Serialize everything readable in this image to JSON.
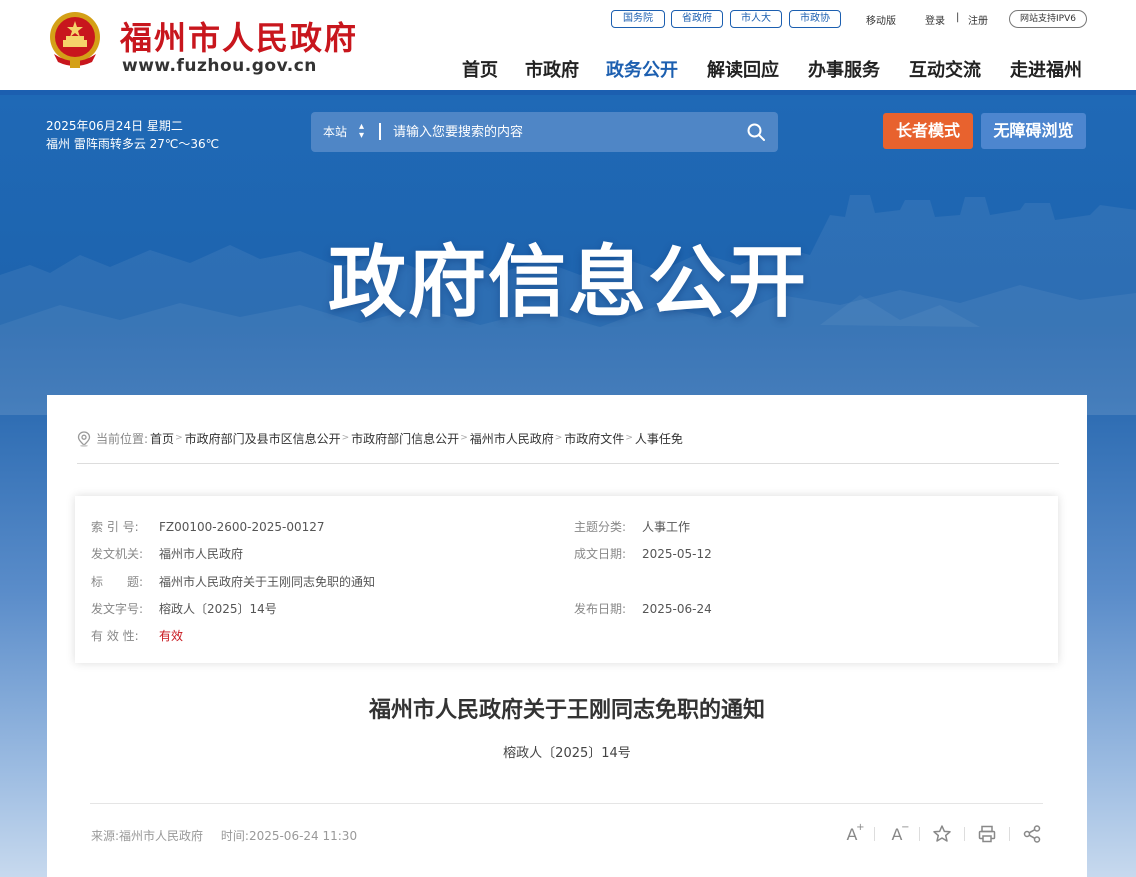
{
  "header": {
    "site_name": "福州市人民政府",
    "site_url": "www.fuzhou.gov.cn",
    "top_links": [
      "国务院",
      "省政府",
      "市人大",
      "市政协"
    ],
    "mobile": "移动版",
    "login": "登录",
    "register": "注册",
    "ipv6": "网站支持IPV6",
    "nav": [
      "首页",
      "市政府",
      "政务公开",
      "解读回应",
      "办事服务",
      "互动交流",
      "走进福州"
    ],
    "nav_active": "政务公开"
  },
  "toolbar": {
    "date": "2025年06月24日 星期二",
    "weather": "福州 雷阵雨转多云 27℃～36℃",
    "search_scope": "本站",
    "search_placeholder": "请输入您要搜索的内容",
    "elder_mode": "长者模式",
    "accessible": "无障碍浏览"
  },
  "banner": {
    "title": "政府信息公开"
  },
  "breadcrumb": {
    "label": "当前位置:",
    "items": [
      "首页",
      "市政府部门及县市区信息公开",
      "市政府部门信息公开",
      "福州市人民政府",
      "市政府文件",
      "人事任免"
    ]
  },
  "meta": {
    "index_label": "索 引 号:",
    "index": "FZ00100-2600-2025-00127",
    "category_label": "主题分类:",
    "category": "人事工作",
    "issuer_label": "发文机关:",
    "issuer": "福州市人民政府",
    "created_label": "成文日期:",
    "created": "2025-05-12",
    "title_label": "标　　题:",
    "title": "福州市人民政府关于王刚同志免职的通知",
    "doc_no_label": "发文字号:",
    "doc_no": "榕政人〔2025〕14号",
    "published_label": "发布日期:",
    "published": "2025-06-24",
    "validity_label": "有 效 性:",
    "validity": "有效"
  },
  "article": {
    "title": "福州市人民政府关于王刚同志免职的通知",
    "doc_no": "榕政人〔2025〕14号",
    "source_label": "来源:",
    "source": "福州市人民政府",
    "time_label": "时间:",
    "time": "2025-06-24 11:30"
  },
  "tools": {
    "font_large": "A",
    "font_large_sup": "+",
    "font_small": "A",
    "font_small_sup": "−"
  },
  "colors": {
    "brand_blue": "#1c5fb0",
    "brand_red": "#c8161d",
    "elder_orange": "#e8622e"
  }
}
